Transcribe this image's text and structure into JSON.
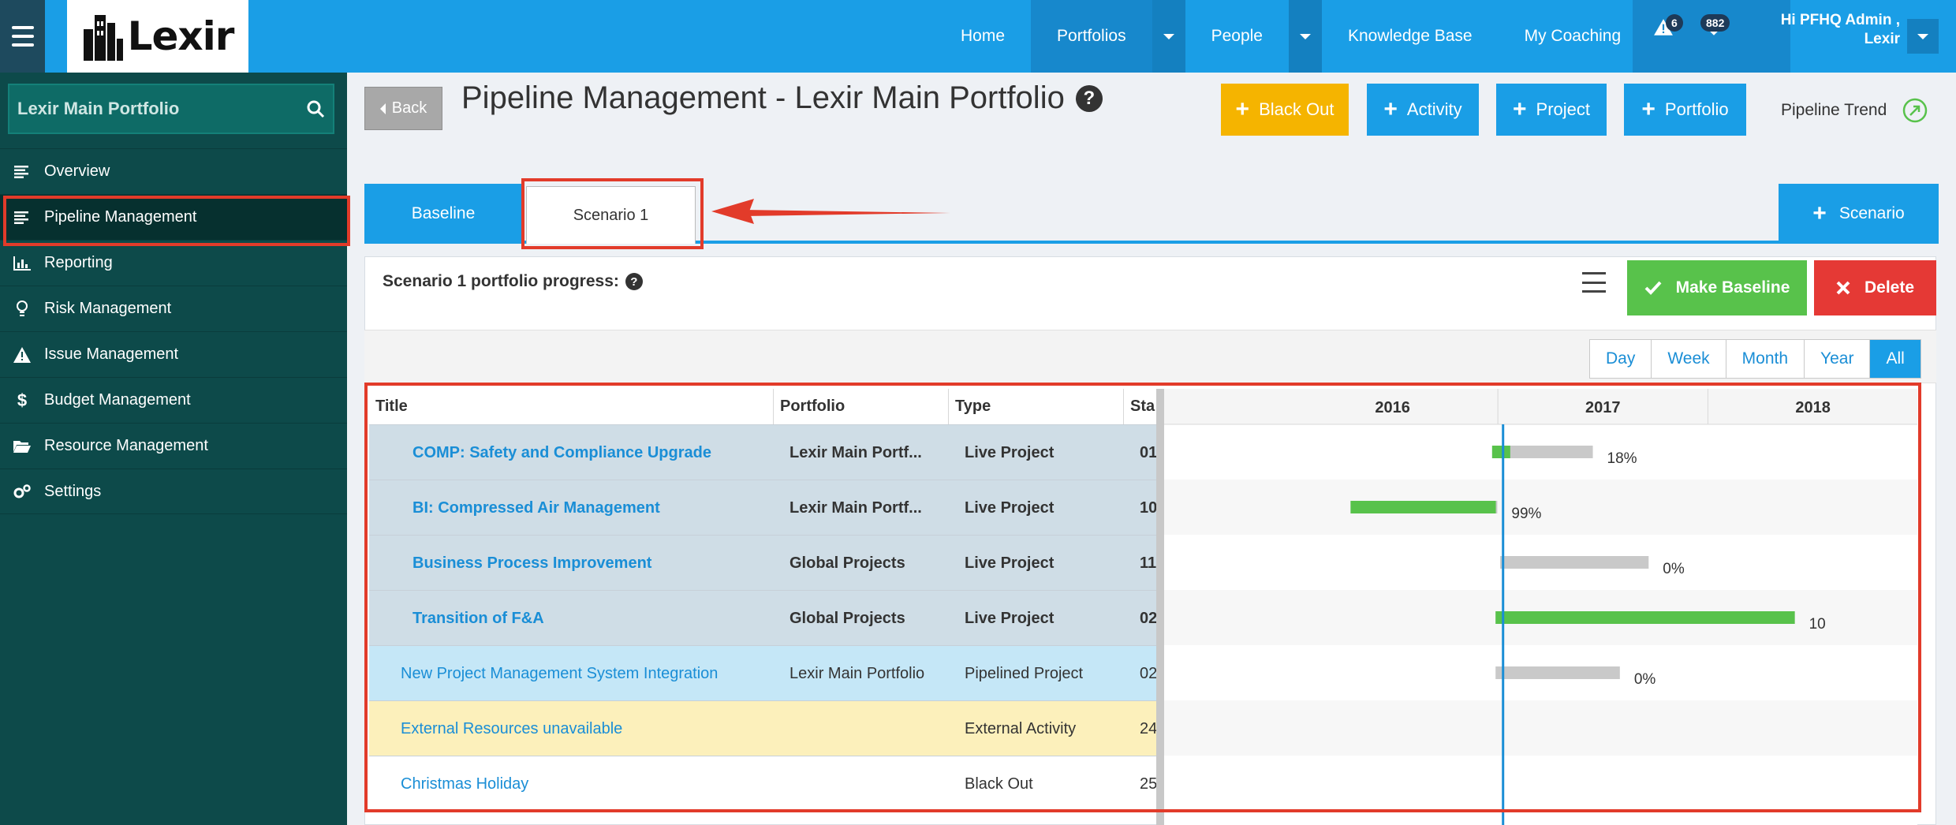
{
  "app": {
    "logo_text": "Lexir"
  },
  "nav": {
    "items": [
      "Home",
      "Portfolios",
      "People",
      "Knowledge Base",
      "My Coaching"
    ],
    "notifications": {
      "alerts_count": "6",
      "messages_count": "882"
    },
    "user": {
      "greeting": "Hi PFHQ Admin ,",
      "org": "Lexir"
    }
  },
  "sidebar": {
    "search_placeholder": "Lexir Main Portfolio",
    "items": [
      {
        "label": "Overview",
        "icon": "list-icon"
      },
      {
        "label": "Pipeline Management",
        "icon": "list-icon",
        "active": true
      },
      {
        "label": "Reporting",
        "icon": "bar-chart-icon"
      },
      {
        "label": "Risk Management",
        "icon": "lightbulb-icon"
      },
      {
        "label": "Issue Management",
        "icon": "warning-icon"
      },
      {
        "label": "Budget Management",
        "icon": "dollar-icon"
      },
      {
        "label": "Resource Management",
        "icon": "folder-open-icon"
      },
      {
        "label": "Settings",
        "icon": "cogs-icon"
      }
    ]
  },
  "header": {
    "back_label": "Back",
    "title": "Pipeline Management - Lexir Main Portfolio",
    "buttons": {
      "blackout": "Black Out",
      "activity": "Activity",
      "project": "Project",
      "portfolio": "Portfolio"
    },
    "trend_label": "Pipeline Trend"
  },
  "tabs": {
    "baseline": "Baseline",
    "scenario1": "Scenario 1",
    "add_scenario": "Scenario"
  },
  "panel": {
    "progress_label": "Scenario 1 portfolio progress:",
    "make_baseline": "Make Baseline",
    "delete": "Delete",
    "views": [
      "Day",
      "Week",
      "Month",
      "Year",
      "All"
    ],
    "active_view": "All"
  },
  "grid": {
    "columns": [
      "Title",
      "Portfolio",
      "Type",
      "Sta"
    ],
    "rows": [
      {
        "title": "COMP: Safety and Compliance Upgrade",
        "portfolio": "Lexir Main Portf...",
        "type": "Live Project",
        "start": "01",
        "bold": true,
        "bg": "#cfdde6",
        "bar": {
          "start": "2016-12-22",
          "planned_end": "2017-06-15",
          "progress": 0.18
        },
        "pct_label": "18%"
      },
      {
        "title": "BI: Compressed Air Management",
        "portfolio": "Lexir Main Portf...",
        "type": "Live Project",
        "start": "10",
        "bold": true,
        "bg": "#cfdde6",
        "bar": {
          "start": "2016-04-20",
          "planned_end": "2016-12-31",
          "progress": 0.99
        },
        "pct_label": "99%"
      },
      {
        "title": "Business Process Improvement",
        "portfolio": "Global Projects",
        "type": "Live Project",
        "start": "11",
        "bold": true,
        "bg": "#cfdde6",
        "bar": {
          "start": "2017-01-05",
          "planned_end": "2017-09-20",
          "progress": 0
        },
        "pct_label": "0%"
      },
      {
        "title": "Transition of F&A",
        "portfolio": "Global Projects",
        "type": "Live Project",
        "start": "02",
        "bold": true,
        "bg": "#cfdde6",
        "bar": {
          "start": "2016-12-28",
          "planned_end": "2018-06-01",
          "progress": 1
        },
        "pct_label": "10"
      },
      {
        "title": "New Project Management System Integration",
        "portfolio": "Lexir Main Portfolio",
        "type": "Pipelined Project",
        "start": "02",
        "bold": false,
        "bg": "#c5e7f7",
        "bar": {
          "start": "2016-12-28",
          "planned_end": "2017-08-01",
          "progress": 0
        },
        "pct_label": "0%"
      },
      {
        "title": "External Resources unavailable",
        "portfolio": "",
        "type": "External Activity",
        "start": "24",
        "bold": false,
        "bg": "#fcf0bb"
      },
      {
        "title": "Christmas Holiday",
        "portfolio": "",
        "type": "Black Out",
        "start": "25",
        "bold": false,
        "bg": "#ffffff"
      }
    ]
  },
  "gantt": {
    "years": [
      "2016",
      "2017",
      "2018"
    ],
    "today": "2017-01-10",
    "x_range": [
      "2015-06-01",
      "2018-12-31"
    ]
  },
  "colors": {
    "accent": "#1a9ee6",
    "sidebar_bg": "#0d4a4a",
    "blackout_btn": "#f5b400",
    "make_baseline_btn": "#58c24b",
    "delete_btn": "#e53935",
    "highlight": "#e23b2a",
    "progress_fill": "#58c24b",
    "progress_track": "#c9c9c9"
  }
}
